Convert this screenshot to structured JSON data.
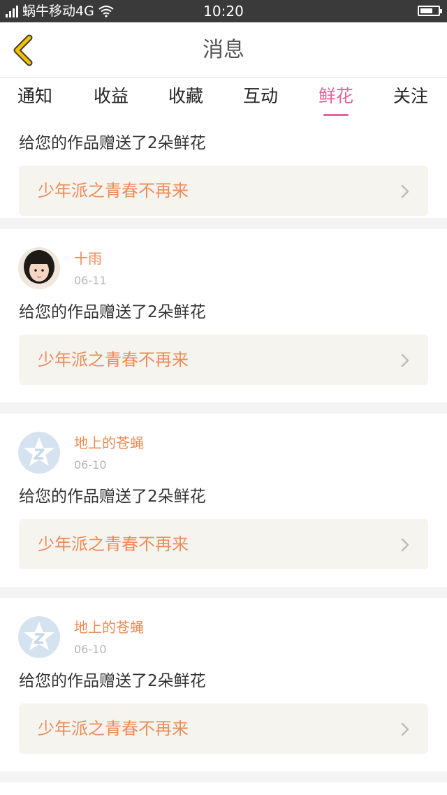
{
  "status_bar": {
    "network": "4G",
    "carrier": "蜗牛移动4G",
    "time": "10:20"
  },
  "header": {
    "title": "消息",
    "back_icon": "back-chevron-icon",
    "accent_color": "#f2c200"
  },
  "tabs": [
    {
      "label": "通知",
      "active": false
    },
    {
      "label": "收益",
      "active": false
    },
    {
      "label": "收藏",
      "active": false
    },
    {
      "label": "互动",
      "active": false
    },
    {
      "label": "鲜花",
      "active": true
    },
    {
      "label": "关注",
      "active": false
    }
  ],
  "colors": {
    "active_tab": "#e5639a",
    "username": "#ee8a55",
    "work_title": "#ef8b58",
    "work_box_bg": "#f5f4ef"
  },
  "items": [
    {
      "message": "给您的作品赠送了2朵鲜花",
      "work_title": "少年派之青春不再来"
    },
    {
      "username": "十雨",
      "date": "06-11",
      "avatar": "user-photo",
      "message": "给您的作品赠送了2朵鲜花",
      "work_title": "少年派之青春不再来"
    },
    {
      "username": "地上的苍蝇",
      "date": "06-10",
      "avatar": "default-star-avatar",
      "message": "给您的作品赠送了2朵鲜花",
      "work_title": "少年派之青春不再来"
    },
    {
      "username": "地上的苍蝇",
      "date": "06-10",
      "avatar": "default-star-avatar",
      "message": "给您的作品赠送了2朵鲜花",
      "work_title": "少年派之青春不再来"
    }
  ]
}
